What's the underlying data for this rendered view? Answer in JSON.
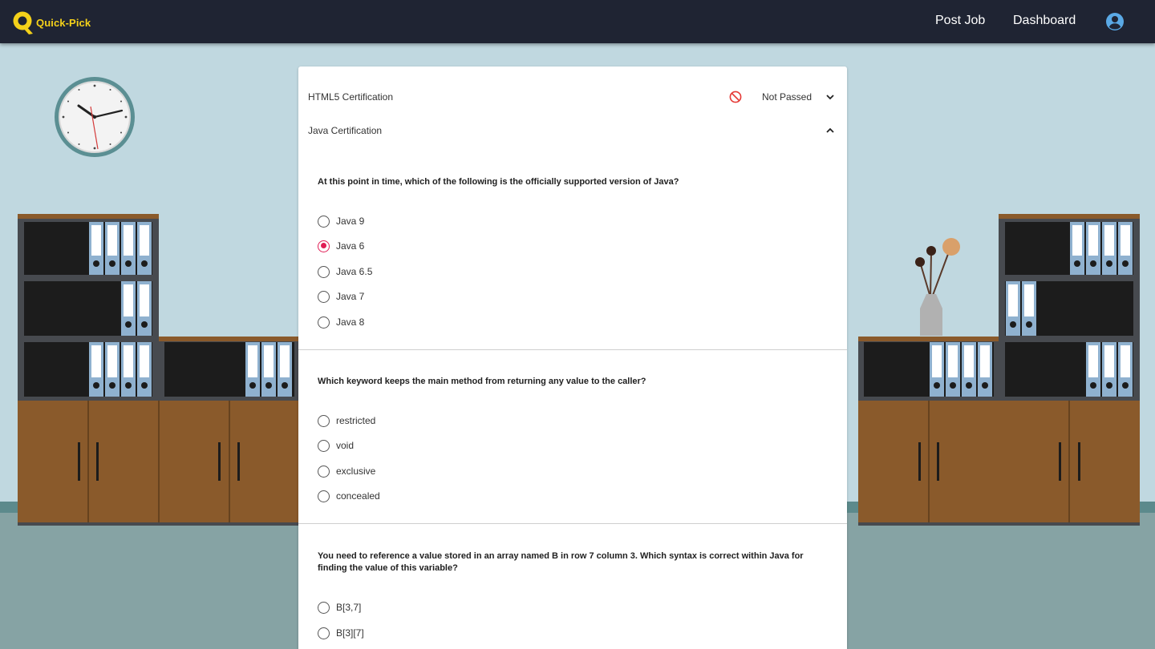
{
  "navbar": {
    "brand": "Quick-Pick",
    "links": [
      {
        "label": "Post Job"
      },
      {
        "label": "Dashboard"
      }
    ]
  },
  "accordion": [
    {
      "title": "HTML5 Certification",
      "status": "Not Passed",
      "expanded": false
    },
    {
      "title": "Java Certification",
      "expanded": true
    }
  ],
  "questions": [
    {
      "text": "At this point in time, which of the following is the officially supported version of Java?",
      "options": [
        "Java 9",
        "Java 6",
        "Java 6.5",
        "Java 7",
        "Java 8"
      ],
      "selected": "Java 6"
    },
    {
      "text": "Which keyword keeps the main method from returning any value to the caller?",
      "options": [
        "restricted",
        "void",
        "exclusive",
        "concealed"
      ],
      "selected": null
    },
    {
      "text": "You need to reference a value stored in an array named B in row 7 column 3. Which syntax is correct within Java for finding the value of this variable?",
      "options": [
        "B[3,7]",
        "B[3][7]"
      ],
      "selected": null
    }
  ],
  "colors": {
    "navbar": "#1f2433",
    "brand": "#f4d11a",
    "accent": "#e01d55",
    "status_icon": "#e53935",
    "avatar": "#5aa9e6"
  },
  "icons": {
    "status": "not-passed-icon",
    "collapsed": "chevron-down-icon",
    "expanded": "chevron-up-icon",
    "profile": "account-circle-icon"
  }
}
